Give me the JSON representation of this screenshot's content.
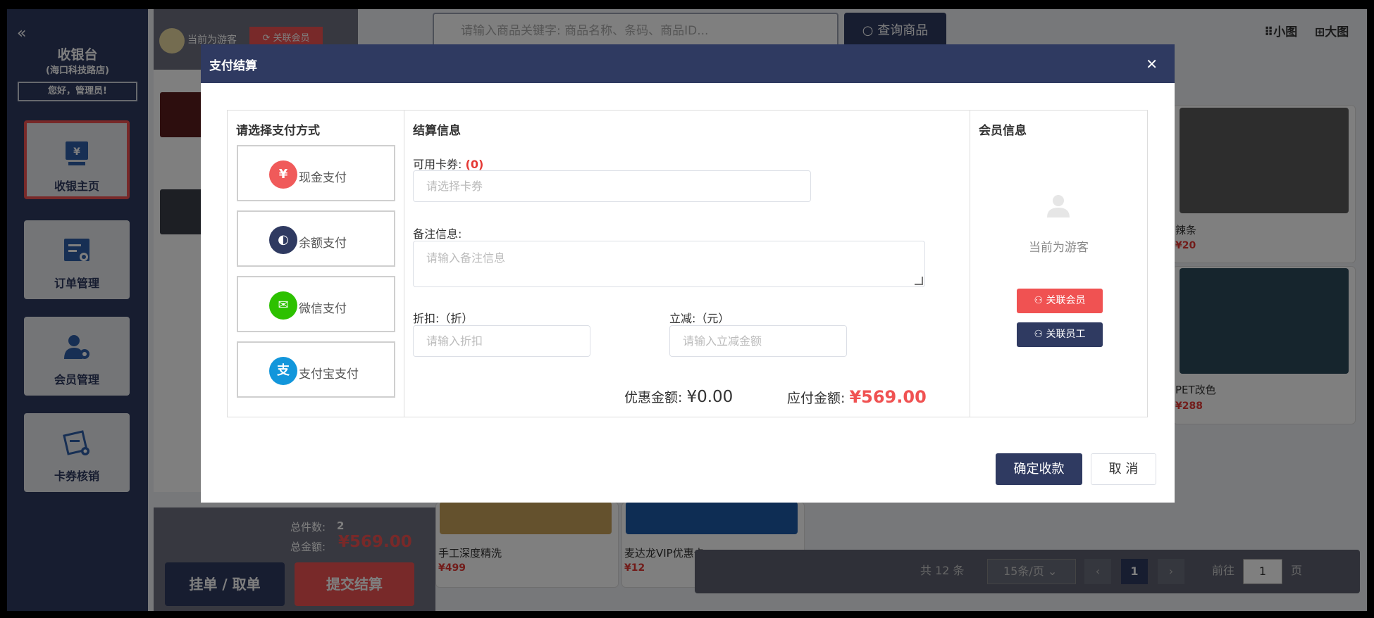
{
  "sidebar": {
    "title": "收银台",
    "store": "(海口科技路店)",
    "greeting": "您好，管理员!",
    "nav": [
      {
        "label": "收银主页"
      },
      {
        "label": "订单管理"
      },
      {
        "label": "会员管理"
      },
      {
        "label": "卡券核销"
      }
    ]
  },
  "topbar": {
    "guest_text": "当前为游客",
    "link_member": "关联会员",
    "search_placeholder": "请输入商品关键字: 商品名称、条码、商品ID...",
    "search_button": "查询商品",
    "view_small": "小图",
    "view_large": "大图"
  },
  "products": [
    {
      "name": "辣条",
      "price": "¥20"
    },
    {
      "name": "PET改色",
      "price": "¥288"
    },
    {
      "name": "手工深度精洗",
      "price": "¥499"
    },
    {
      "name": "麦达龙VIP优惠卡",
      "price": "¥12"
    }
  ],
  "cart_summary": {
    "total_items_label": "总件数:",
    "total_items": "2",
    "total_amount_label": "总金额:",
    "total_amount": "¥569.00",
    "hold_button": "挂单 / 取单",
    "submit_button": "提交结算"
  },
  "pagination": {
    "total": "共 12 条",
    "page_size": "15条/页",
    "current_page": "1",
    "goto_label": "前往",
    "goto_value": "1",
    "page_suffix": "页"
  },
  "modal": {
    "title": "支付结算",
    "payment_section_title": "请选择支付方式",
    "payment_methods": [
      {
        "label": "现金支付",
        "color": "#f05a5a"
      },
      {
        "label": "余额支付",
        "color": "#2f3a61"
      },
      {
        "label": "微信支付",
        "color": "#2dc100"
      },
      {
        "label": "支付宝支付",
        "color": "#1296db"
      }
    ],
    "settle_section_title": "结算信息",
    "coupon_label": "可用卡券:",
    "coupon_count": "(0)",
    "coupon_placeholder": "请选择卡券",
    "remark_label": "备注信息:",
    "remark_placeholder": "请输入备注信息",
    "discount_label": "折扣:（折）",
    "discount_placeholder": "请输入折扣",
    "reduce_label": "立减:（元）",
    "reduce_placeholder": "请输入立减金额",
    "discount_amount_label": "优惠金额:",
    "discount_amount": "¥0.00",
    "payable_label": "应付金额:",
    "payable_amount": "¥569.00",
    "member_section_title": "会员信息",
    "member_guest_text": "当前为游客",
    "link_member_button": "关联会员",
    "link_staff_button": "关联员工",
    "confirm_button": "确定收款",
    "cancel_button": "取 消"
  },
  "colors": {
    "primary": "#2f3a61",
    "danger": "#f05252"
  }
}
